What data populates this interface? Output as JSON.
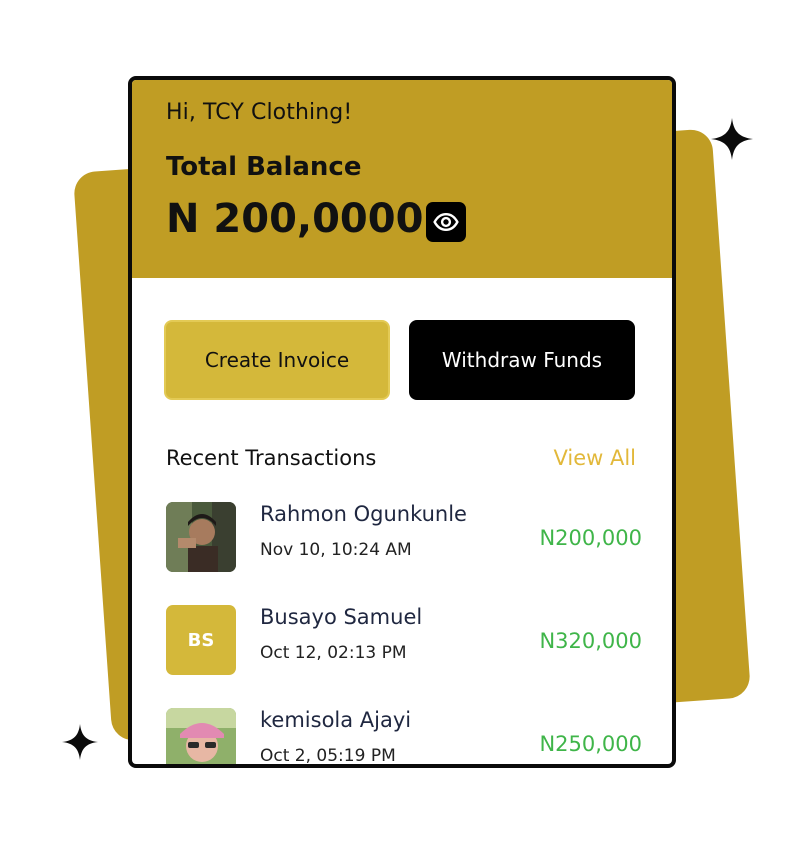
{
  "header": {
    "greeting": "Hi, TCY Clothing!",
    "balance_label": "Total Balance",
    "balance_amount": "N 200,0000"
  },
  "icons": {
    "eye": "eye-icon",
    "sparkle": "sparkle-icon"
  },
  "actions": {
    "create_label": "Create Invoice",
    "withdraw_label": "Withdraw Funds"
  },
  "transactions_section": {
    "title": "Recent Transactions",
    "view_all": "View All"
  },
  "transactions": [
    {
      "name": "Rahmon Ogunkunle",
      "time": "Nov 10, 10:24 AM",
      "amount": "N200,000",
      "avatar": "photo"
    },
    {
      "name": "Busayo Samuel",
      "time": "Oct 12, 02:13 PM",
      "amount": "N320,000",
      "avatar": "initials",
      "initials": "BS"
    },
    {
      "name": "kemisola Ajayi",
      "time": "Oct 2, 05:19 PM",
      "amount": "N250,000",
      "avatar": "photo"
    }
  ],
  "colors": {
    "brand_gold": "#c09d24",
    "button_gold": "#d4b83a",
    "link_gold": "#e2b83a",
    "amount_green": "#3fb549",
    "dark": "#000000"
  }
}
